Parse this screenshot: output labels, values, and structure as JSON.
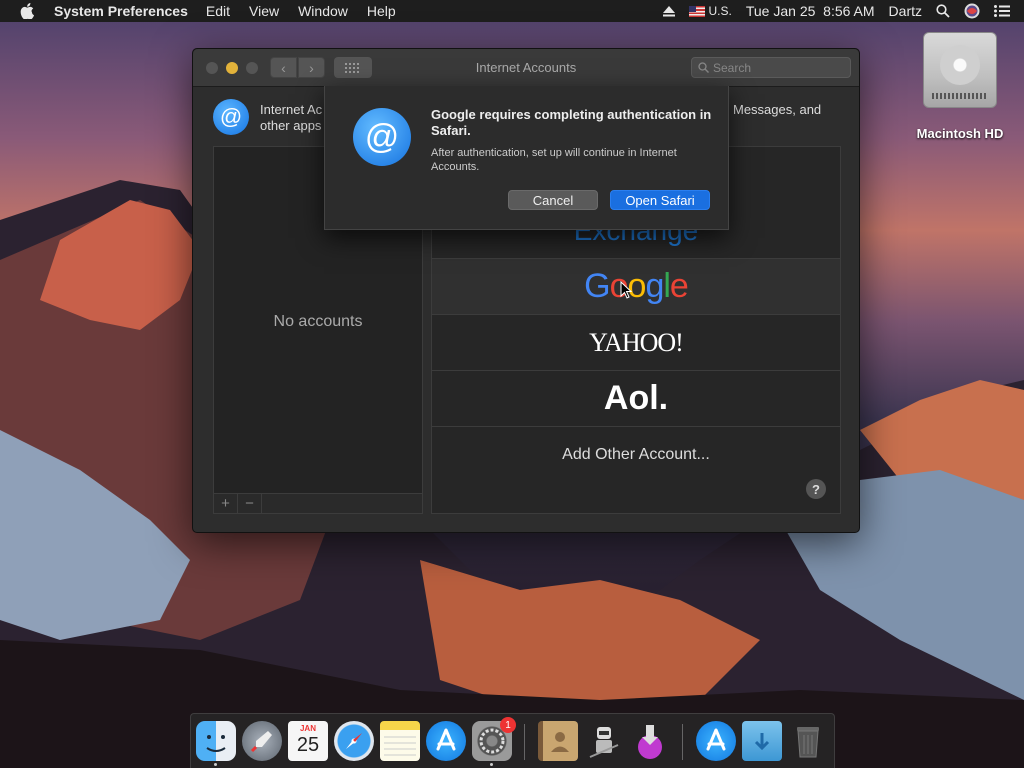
{
  "menubar": {
    "app_name": "System Preferences",
    "menus": [
      "Edit",
      "View",
      "Window",
      "Help"
    ],
    "input_source": "U.S.",
    "datetime": "Tue Jan 25  8:56 AM",
    "user": "Dartz"
  },
  "desktop": {
    "hd_label": "Macintosh HD"
  },
  "window": {
    "title": "Internet Accounts",
    "search_placeholder": "Search",
    "header_left_line1": "Internet Ac",
    "header_left_line2": "other apps",
    "header_right": "Messages, and",
    "no_accounts": "No accounts",
    "add_label": "+",
    "remove_label": "−",
    "providers": {
      "exchange": "Exchange",
      "google": "Google",
      "yahoo": "YAHOO!",
      "aol": "Aol.",
      "other": "Add Other Account..."
    },
    "help": "?"
  },
  "dialog": {
    "title": "Google requires completing authentication in Safari.",
    "message": "After authentication, set up will continue in Internet Accounts.",
    "cancel": "Cancel",
    "open": "Open Safari"
  },
  "dock": {
    "calendar_month": "JAN",
    "calendar_day": "25",
    "prefs_badge": "1"
  }
}
